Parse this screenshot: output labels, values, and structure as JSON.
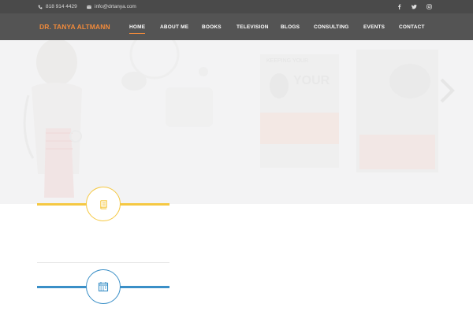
{
  "topbar": {
    "phone": "818 914 4429",
    "email": "info@drtanya.com",
    "social": [
      "facebook-icon",
      "twitter-icon",
      "instagram-icon"
    ]
  },
  "brand": {
    "logo_text": "DR. TANYA ALTMANN"
  },
  "nav": {
    "items": [
      {
        "label": "HOME",
        "active": true
      },
      {
        "label": "ABOUT ME"
      },
      {
        "label": "BOOKS"
      },
      {
        "label": "TELEVISION"
      },
      {
        "label": "BLOGS"
      },
      {
        "label": "CONSULTING"
      },
      {
        "label": "EVENTS"
      },
      {
        "label": "CONTACT"
      }
    ]
  },
  "sections": [
    {
      "icon": "book-icon",
      "color": "#f5c842"
    },
    {
      "icon": "calendar-icon",
      "color": "#3a8fc7"
    }
  ],
  "colors": {
    "accent": "#f08a3b",
    "topbar_bg": "#4a4a4a",
    "nav_bg": "#545454"
  }
}
